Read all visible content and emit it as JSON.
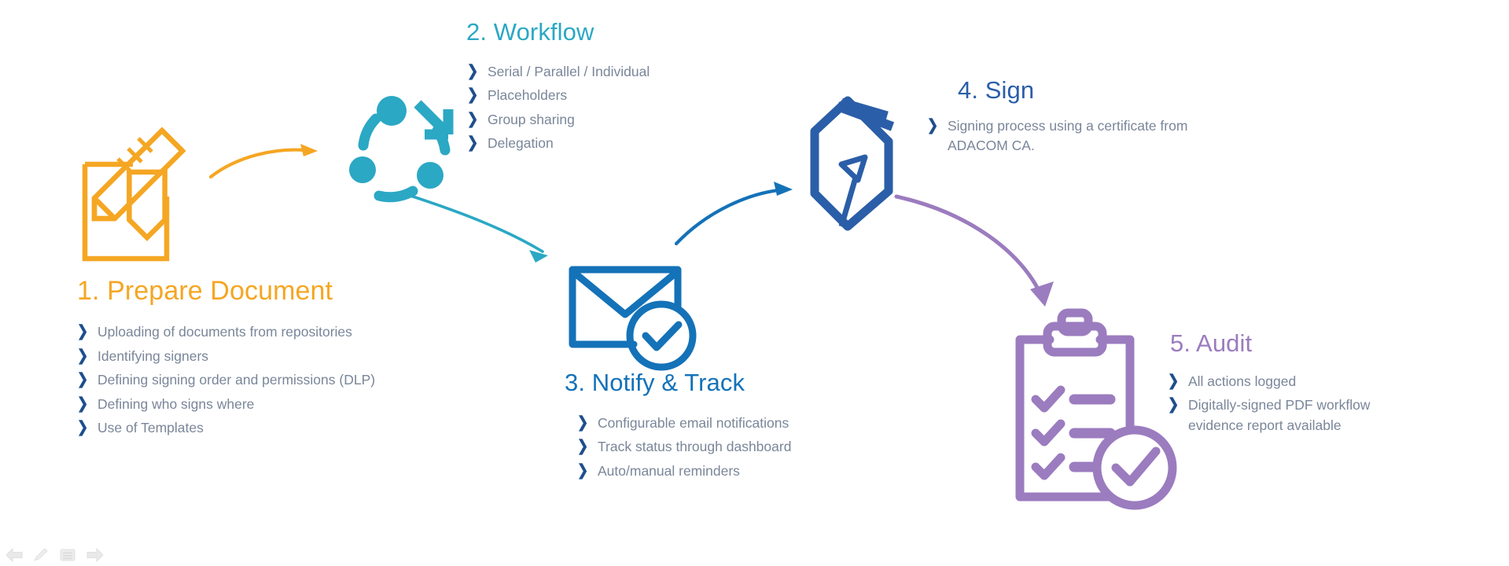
{
  "page": {
    "background": "#ffffff",
    "bullet_chevron_color": "#1F4E8C",
    "bullet_text_color": "#7A8699"
  },
  "steps": [
    {
      "id": "prepare",
      "number": "1.",
      "title": "1.   Prepare Document",
      "color": "#F5A623",
      "icon": "document-pencil-icon",
      "bullets": [
        "Uploading of documents from repositories",
        "Identifying signers",
        "Defining signing order and permissions (DLP)",
        "Defining who signs where",
        "Use of Templates"
      ]
    },
    {
      "id": "workflow",
      "number": "2.",
      "title": "2. Workflow",
      "color": "#2BA8C4",
      "icon": "circular-workflow-icon",
      "bullets": [
        "Serial / Parallel / Individual",
        "Placeholders",
        "Group sharing",
        "Delegation"
      ]
    },
    {
      "id": "notify",
      "number": "3.",
      "title": "3. Notify & Track",
      "color": "#1472B8",
      "icon": "envelope-check-icon",
      "bullets": [
        "Configurable email notifications",
        "Track status through dashboard",
        "Auto/manual reminders"
      ]
    },
    {
      "id": "sign",
      "number": "4.",
      "title": "4. Sign",
      "color": "#2B5EA8",
      "icon": "pen-nib-icon",
      "bullets": [
        "Signing process using a certificate from ADACOM CA."
      ]
    },
    {
      "id": "audit",
      "number": "5.",
      "title": "5. Audit",
      "color": "#9B7CBF",
      "icon": "clipboard-check-icon",
      "bullets": [
        "All actions logged",
        "Digitally-signed PDF workflow evidence report available"
      ]
    }
  ],
  "connectors": [
    {
      "name": "arrow-prepare-to-workflow",
      "color": "#F5A623"
    },
    {
      "name": "arrow-workflow-to-notify",
      "color": "#2BA8C4"
    },
    {
      "name": "arrow-notify-to-sign",
      "color": "#1472B8"
    },
    {
      "name": "arrow-sign-to-audit",
      "color": "#9B7CBF"
    }
  ],
  "mini_toolbar": {
    "items": [
      {
        "name": "back-arrow-icon",
        "label": "Back"
      },
      {
        "name": "pencil-icon",
        "label": "Draw"
      },
      {
        "name": "menu-list-icon",
        "label": "Menu"
      },
      {
        "name": "forward-arrow-icon",
        "label": "Forward"
      }
    ],
    "color": "#E6E6E6"
  }
}
